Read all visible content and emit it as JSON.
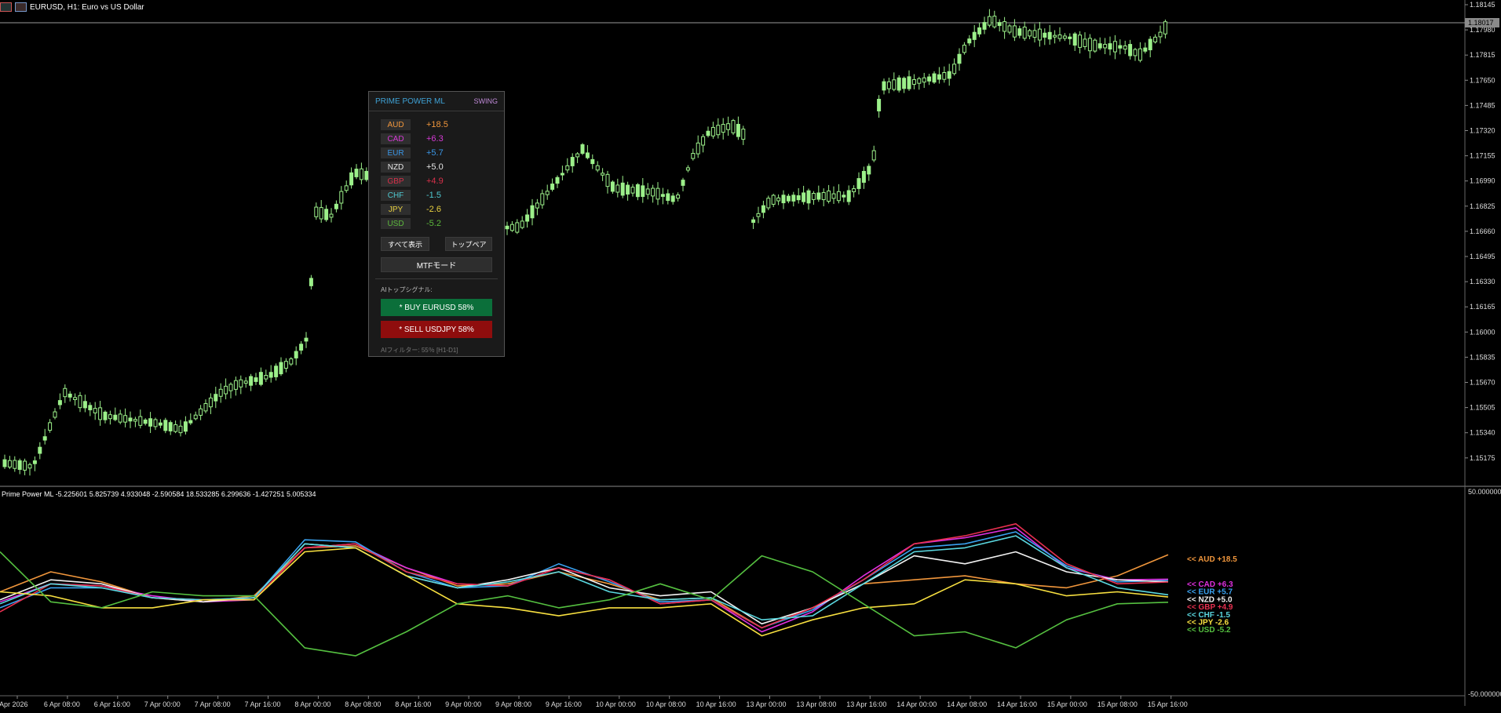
{
  "window": {
    "title": "EURUSD, H1:  Euro vs US Dollar"
  },
  "price_axis": {
    "labels": [
      "1.18145",
      "1.17980",
      "1.17815",
      "1.17650",
      "1.17485",
      "1.17320",
      "1.17155",
      "1.16990",
      "1.16825",
      "1.16660",
      "1.16495",
      "1.16330",
      "1.16165",
      "1.16000",
      "1.15835",
      "1.15670",
      "1.15505",
      "1.15340",
      "1.15175"
    ],
    "current_price": "1.18017"
  },
  "time_axis": {
    "labels": [
      "6 Apr 2026",
      "6 Apr 08:00",
      "6 Apr 16:00",
      "7 Apr 00:00",
      "7 Apr 08:00",
      "7 Apr 16:00",
      "8 Apr 00:00",
      "8 Apr 08:00",
      "8 Apr 16:00",
      "9 Apr 00:00",
      "9 Apr 08:00",
      "9 Apr 16:00",
      "10 Apr 00:00",
      "10 Apr 08:00",
      "10 Apr 16:00",
      "13 Apr 00:00",
      "13 Apr 08:00",
      "13 Apr 16:00",
      "14 Apr 00:00",
      "14 Apr 08:00",
      "14 Apr 16:00",
      "15 Apr 00:00",
      "15 Apr 08:00",
      "15 Apr 16:00"
    ]
  },
  "indicator": {
    "title": "Prime Power ML -5.225601 5.825739 4.933048 -2.590584 18.533285 6.299636 -1.427251 5.005334",
    "axis_top": "50.000000",
    "axis_bottom": "-50.000000",
    "labels": [
      {
        "text": "<< AUD +18.5",
        "color": "#f0963c"
      },
      {
        "text": "<< CAD +6.3",
        "color": "#e030e0"
      },
      {
        "text": "<< EUR +5.7",
        "color": "#3aa2f0"
      },
      {
        "text": "<< NZD +5.0",
        "color": "#f2f2f2"
      },
      {
        "text": "<< GBP +4.9",
        "color": "#e83050"
      },
      {
        "text": "<< CHF -1.5",
        "color": "#5ad8e0"
      },
      {
        "text": "<< JPY -2.6",
        "color": "#f8e040"
      },
      {
        "text": "<< USD -5.2",
        "color": "#55c040"
      }
    ]
  },
  "panel": {
    "title": "PRIME POWER ML",
    "mode": "SWING",
    "currencies": [
      {
        "code": "AUD",
        "value": "+18.5",
        "code_color": "#f0963c",
        "value_color": "#f0963c"
      },
      {
        "code": "CAD",
        "value": "+6.3",
        "code_color": "#d63ad6",
        "value_color": "#d63ad6"
      },
      {
        "code": "EUR",
        "value": "+5.7",
        "code_color": "#3a96e6",
        "value_color": "#3a96e6"
      },
      {
        "code": "NZD",
        "value": "+5.0",
        "code_color": "#e6e6e6",
        "value_color": "#e6e6e6"
      },
      {
        "code": "GBP",
        "value": "+4.9",
        "code_color": "#d8304a",
        "value_color": "#d8304a"
      },
      {
        "code": "CHF",
        "value": "-1.5",
        "code_color": "#4fc8d0",
        "value_color": "#4fc8d0"
      },
      {
        "code": "JPY",
        "value": "-2.6",
        "code_color": "#e8d040",
        "value_color": "#e8d040"
      },
      {
        "code": "USD",
        "value": "-5.2",
        "code_color": "#5cb83c",
        "value_color": "#5cb83c"
      }
    ],
    "show_all_label": "すべて表示",
    "top_pair_label": "トップペア",
    "mtf_label": "MTFモード",
    "signals_title": "AIトップシグナル:",
    "buy_signal": "* BUY EURUSD 58%",
    "sell_signal": "* SELL USDJPY 58%",
    "filter_text": "AIフィルター: 55％ [H1-D1]"
  },
  "chart_data": {
    "type": "line",
    "title": "",
    "xlabel": "",
    "ylabel": "",
    "ylim": [
      -50,
      50
    ],
    "x": [
      "6 Apr 2026",
      "6 Apr 08:00",
      "6 Apr 16:00",
      "7 Apr 00:00",
      "7 Apr 08:00",
      "7 Apr 16:00",
      "8 Apr 00:00",
      "8 Apr 08:00",
      "8 Apr 16:00",
      "9 Apr 00:00",
      "9 Apr 08:00",
      "9 Apr 16:00",
      "10 Apr 00:00",
      "10 Apr 08:00",
      "10 Apr 16:00",
      "13 Apr 00:00",
      "13 Apr 08:00",
      "13 Apr 16:00",
      "14 Apr 00:00",
      "14 Apr 08:00",
      "14 Apr 16:00",
      "15 Apr 00:00",
      "15 Apr 08:00",
      "15 Apr 16:00"
    ],
    "series": [
      {
        "name": "AUD",
        "color": "#f0963c",
        "values": [
          0,
          10,
          5,
          -3,
          -5,
          -2,
          22,
          23,
          12,
          3,
          4,
          10,
          4,
          -4,
          -3,
          -18,
          -8,
          4,
          6,
          8,
          4,
          2,
          8,
          18.5
        ]
      },
      {
        "name": "CAD",
        "color": "#e030e0",
        "values": [
          -5,
          4,
          3,
          -2,
          -5,
          -4,
          22,
          24,
          12,
          4,
          3,
          12,
          6,
          -6,
          -4,
          -20,
          -10,
          8,
          24,
          27,
          32,
          12,
          6,
          6.3
        ]
      },
      {
        "name": "EUR",
        "color": "#3aa2f0",
        "values": [
          -8,
          2,
          2,
          -3,
          -4,
          -3,
          26,
          25,
          10,
          2,
          3,
          14,
          5,
          -5,
          -4,
          -18,
          -9,
          6,
          22,
          24,
          30,
          13,
          5,
          5.7
        ]
      },
      {
        "name": "NZD",
        "color": "#f2f2f2",
        "values": [
          -4,
          6,
          4,
          -3,
          -5,
          -3,
          24,
          22,
          8,
          2,
          6,
          12,
          2,
          -2,
          0,
          -16,
          -8,
          4,
          18,
          14,
          20,
          10,
          6,
          5.0
        ]
      },
      {
        "name": "GBP",
        "color": "#e83050",
        "values": [
          -10,
          4,
          3,
          -3,
          -4,
          -4,
          22,
          24,
          10,
          4,
          3,
          12,
          6,
          -6,
          -4,
          -18,
          -8,
          6,
          24,
          28,
          34,
          14,
          4,
          4.9
        ]
      },
      {
        "name": "CHF",
        "color": "#5ad8e0",
        "values": [
          -6,
          4,
          2,
          -3,
          -4,
          -3,
          24,
          22,
          8,
          2,
          5,
          10,
          0,
          -4,
          -3,
          -14,
          -12,
          4,
          20,
          22,
          28,
          12,
          2,
          -1.5
        ]
      },
      {
        "name": "JPY",
        "color": "#f8e040",
        "values": [
          0,
          -2,
          -8,
          -8,
          -4,
          -4,
          20,
          22,
          8,
          -6,
          -8,
          -12,
          -8,
          -8,
          -6,
          -22,
          -14,
          -8,
          -6,
          6,
          4,
          -2,
          0,
          -2.6
        ]
      },
      {
        "name": "USD",
        "color": "#55c040",
        "values": [
          20,
          -5,
          -8,
          0,
          -2,
          -2,
          -28,
          -32,
          -20,
          -6,
          -2,
          -8,
          -4,
          4,
          -4,
          18,
          10,
          -6,
          -22,
          -20,
          -28,
          -14,
          -6,
          -5.2
        ]
      }
    ]
  },
  "colors": {
    "bull_candle": "#9cf08a",
    "grid": "#555555",
    "background": "#000000"
  }
}
